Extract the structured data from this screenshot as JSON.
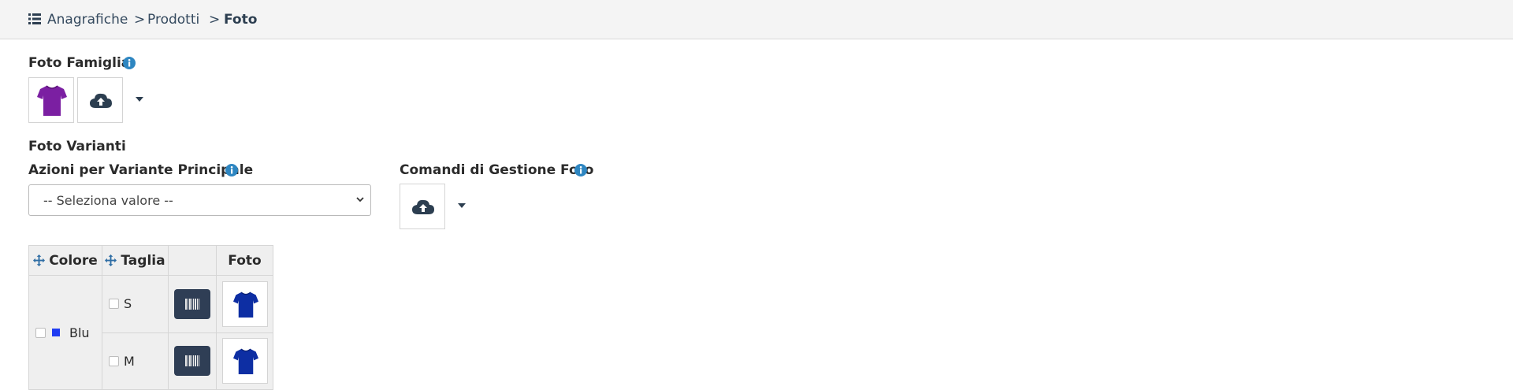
{
  "breadcrumb": {
    "items": [
      {
        "label": "Anagrafiche"
      },
      {
        "label": "Prodotti"
      },
      {
        "label": "Foto"
      }
    ],
    "separator": ">"
  },
  "famiglia": {
    "title": "Foto Famiglia",
    "photo_color": "#7b1fa2"
  },
  "varianti": {
    "title": "Foto Varianti",
    "azioni_label": "Azioni per Variante Principale",
    "azioni_select": "-- Seleziona valore --",
    "comandi_label": "Comandi di Gestione Foto"
  },
  "table": {
    "headers": [
      "Colore",
      "Taglia",
      "",
      "Foto"
    ],
    "colore": {
      "name": "Blu",
      "swatch": "#1f3cf2"
    },
    "rows": [
      {
        "taglia": "S"
      },
      {
        "taglia": "M"
      }
    ]
  },
  "colors": {
    "info": "#2e86c1",
    "dark": "#2c3e50",
    "shirt_blue": "#0d2ea3"
  },
  "icons": [
    "list-icon",
    "info-icon",
    "cloud-upload-icon",
    "caret-down-icon",
    "move-icon",
    "barcode-icon",
    "chevron-down-icon"
  ]
}
